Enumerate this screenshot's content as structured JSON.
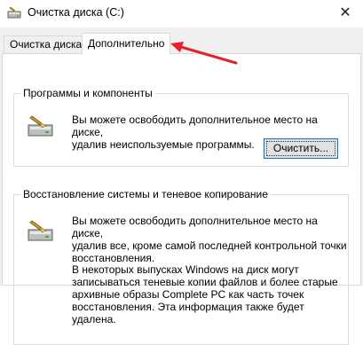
{
  "window": {
    "title": "Очистка диска  (C:)",
    "close_symbol": "✕"
  },
  "tabs": [
    {
      "label": "Очистка диска",
      "active": false
    },
    {
      "label": "Дополнительно",
      "active": true
    }
  ],
  "programs_group": {
    "title": "Программы и компоненты",
    "icon": "hard-drive-cleanup-icon",
    "text_lines": [
      "Вы можете освободить дополнительное место на диске,",
      "удалив неиспользуемые программы."
    ],
    "button_label": "Очистить..."
  },
  "restore_group": {
    "title": "Восстановление системы и теневое копирование",
    "icon": "hard-drive-cleanup-icon",
    "text_lines": [
      "Вы можете освободить дополнительное место на диске,",
      "удалив все, кроме самой последней контрольной точки",
      "восстановления."
    ],
    "note_lines": [
      "В некоторых выпусках Windows на диск могут",
      "записываться теневые копии файлов и более старые",
      "архивные образы Complete PC как часть точек",
      "восстановления. Эта информация также будет удалена."
    ]
  },
  "annotation": {
    "color": "#e8202a"
  }
}
